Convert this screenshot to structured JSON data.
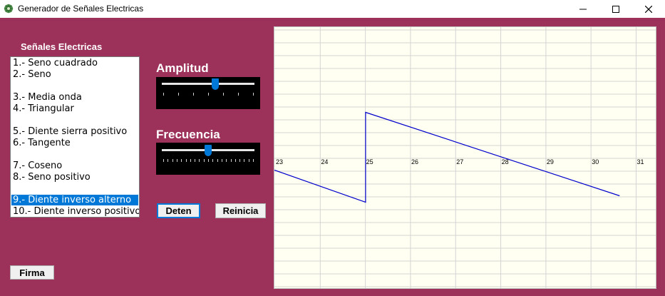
{
  "window": {
    "title": "Generador de Señales Electricas",
    "controls": [
      "minimize",
      "maximize",
      "close"
    ]
  },
  "list": {
    "heading": "Señales Electricas",
    "items": [
      "1.- Seno cuadrado",
      "2.- Seno",
      "",
      "3.- Media onda",
      "4.- Triangular",
      "",
      "5.- Diente sierra positivo",
      "6.- Tangente",
      "",
      "7.- Coseno",
      "8.- Seno positivo",
      "",
      "9.- Diente inverso alterno",
      "10.- Diente inverso positivo"
    ],
    "selected_index": 12
  },
  "amplitude": {
    "label": "Amplitud",
    "value_fraction": 0.58
  },
  "frequency": {
    "label": "Frecuencia",
    "value_fraction": 0.5
  },
  "buttons": {
    "stop": "Deten",
    "reset": "Reinicia",
    "sign": "Firma"
  },
  "colors": {
    "background": "#9c3159",
    "plot_background": "#fffff2",
    "grid": "#d4d4d4",
    "trace": "#0000cc",
    "accent": "#0078d7"
  },
  "chart_data": {
    "type": "line",
    "x_ticks": [
      "23",
      "24",
      "25",
      "26",
      "27",
      "28",
      "29",
      "30",
      "31"
    ],
    "xlim": [
      23,
      31.45
    ],
    "ylim": [
      -1.6,
      1.6
    ],
    "grid": true,
    "series": [
      {
        "values": [
          [
            23,
            -0.15
          ],
          [
            25.02,
            -0.65
          ],
          [
            25.02,
            0.75
          ],
          [
            30.65,
            -0.55
          ]
        ]
      }
    ]
  }
}
